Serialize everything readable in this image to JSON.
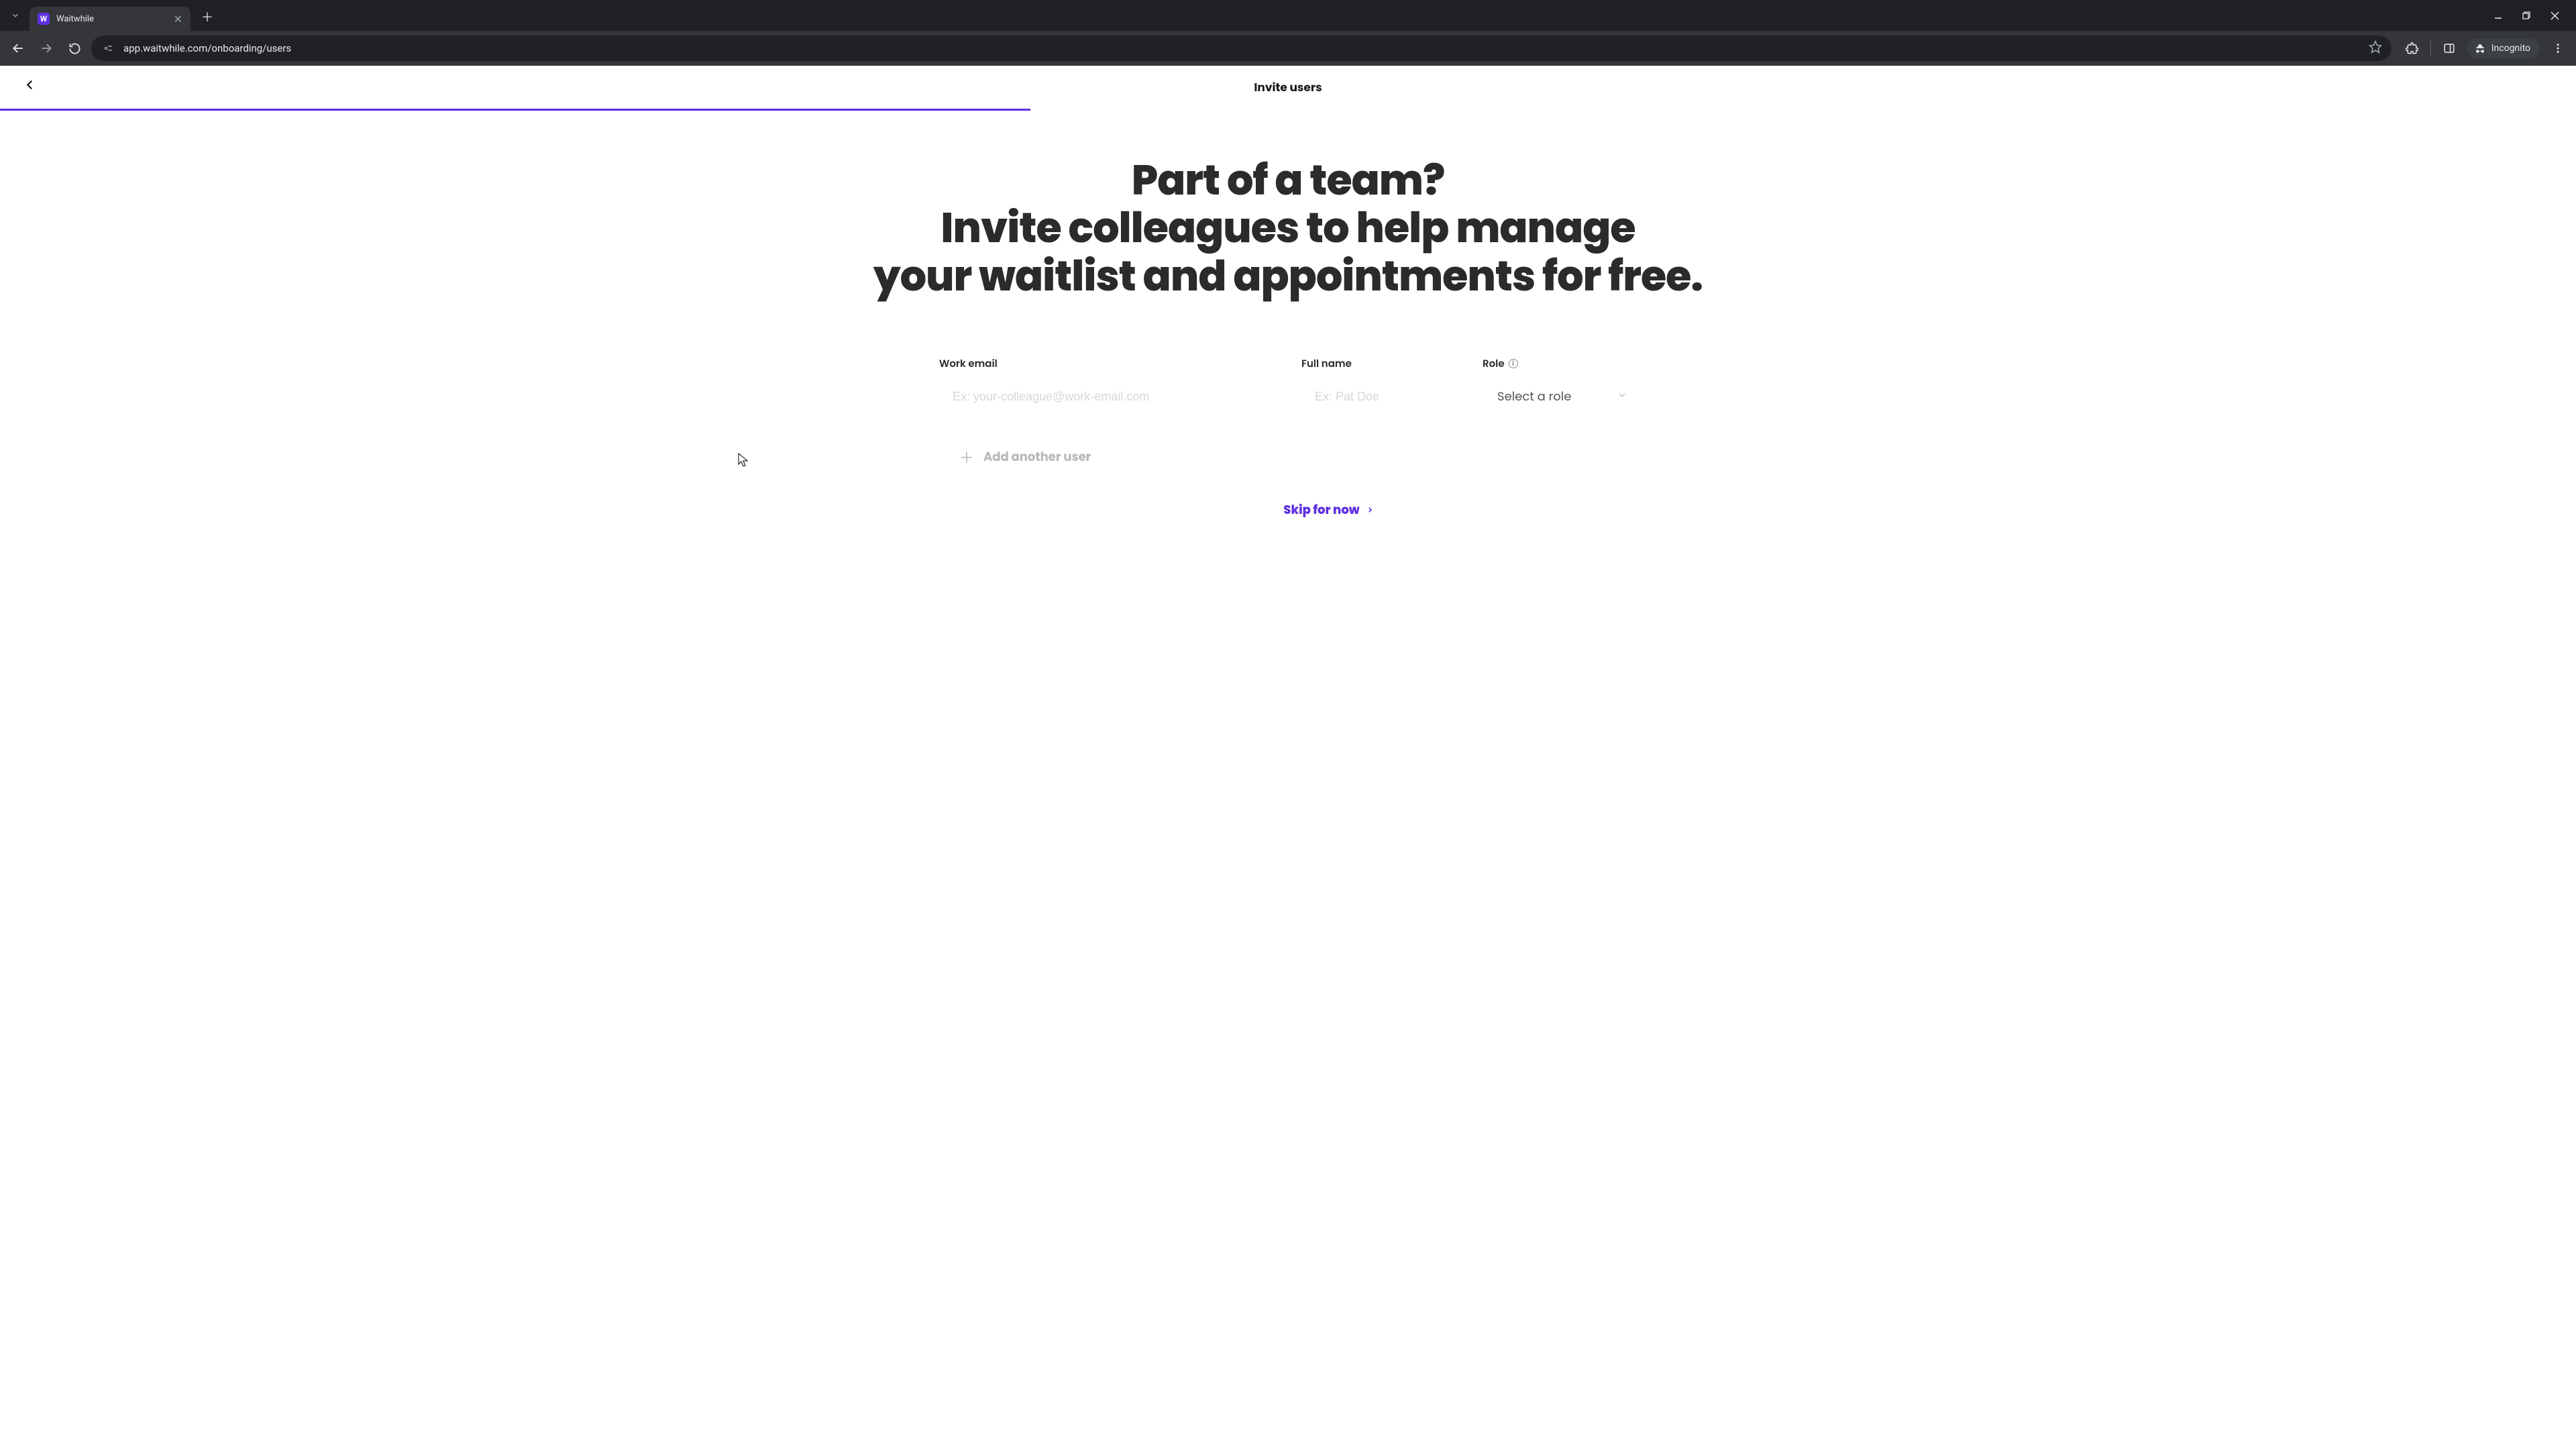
{
  "browser": {
    "tab_title": "Waitwhile",
    "url": "app.waitwhile.com/onboarding/users",
    "incognito_label": "Incognito"
  },
  "header": {
    "title": "Invite users"
  },
  "progress": {
    "percent": 40
  },
  "hero": {
    "line1": "Part of a team?",
    "line2": "Invite colleagues to help manage",
    "line3": "your waitlist and appointments for free."
  },
  "form": {
    "labels": {
      "email": "Work email",
      "name": "Full name",
      "role": "Role"
    },
    "placeholders": {
      "email": "Ex: your-colleague@work-email.com",
      "name": "Ex: Pat Doe"
    },
    "role_placeholder": "Select a role",
    "add_user": "Add another user"
  },
  "footer": {
    "skip": "Skip for now"
  }
}
